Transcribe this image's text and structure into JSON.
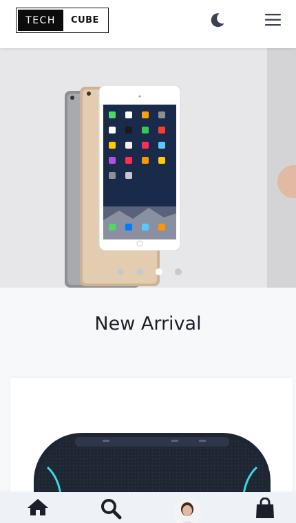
{
  "header": {
    "logo": {
      "left_text": "TECH",
      "right_text": "CUBE"
    },
    "theme_toggle_icon": "moon-icon",
    "menu_icon": "hamburger-menu-icon"
  },
  "carousel": {
    "slide_image": "ipad-family-image",
    "dots_count": 4,
    "active_dot_index": 2
  },
  "section": {
    "title": "New Arrival",
    "product_image": "bluetooth-speaker-image"
  },
  "bottom_nav": {
    "items": [
      "home-icon",
      "search-icon",
      "user-avatar",
      "shopping-bag-icon"
    ]
  },
  "colors": {
    "accent_dark": "#1c1f2a",
    "icon_dark": "#3a4152",
    "carousel_bg": "#e7e7e9",
    "nav_bg": "#eef2f6",
    "speaker_ring": "#3fd6e6"
  }
}
